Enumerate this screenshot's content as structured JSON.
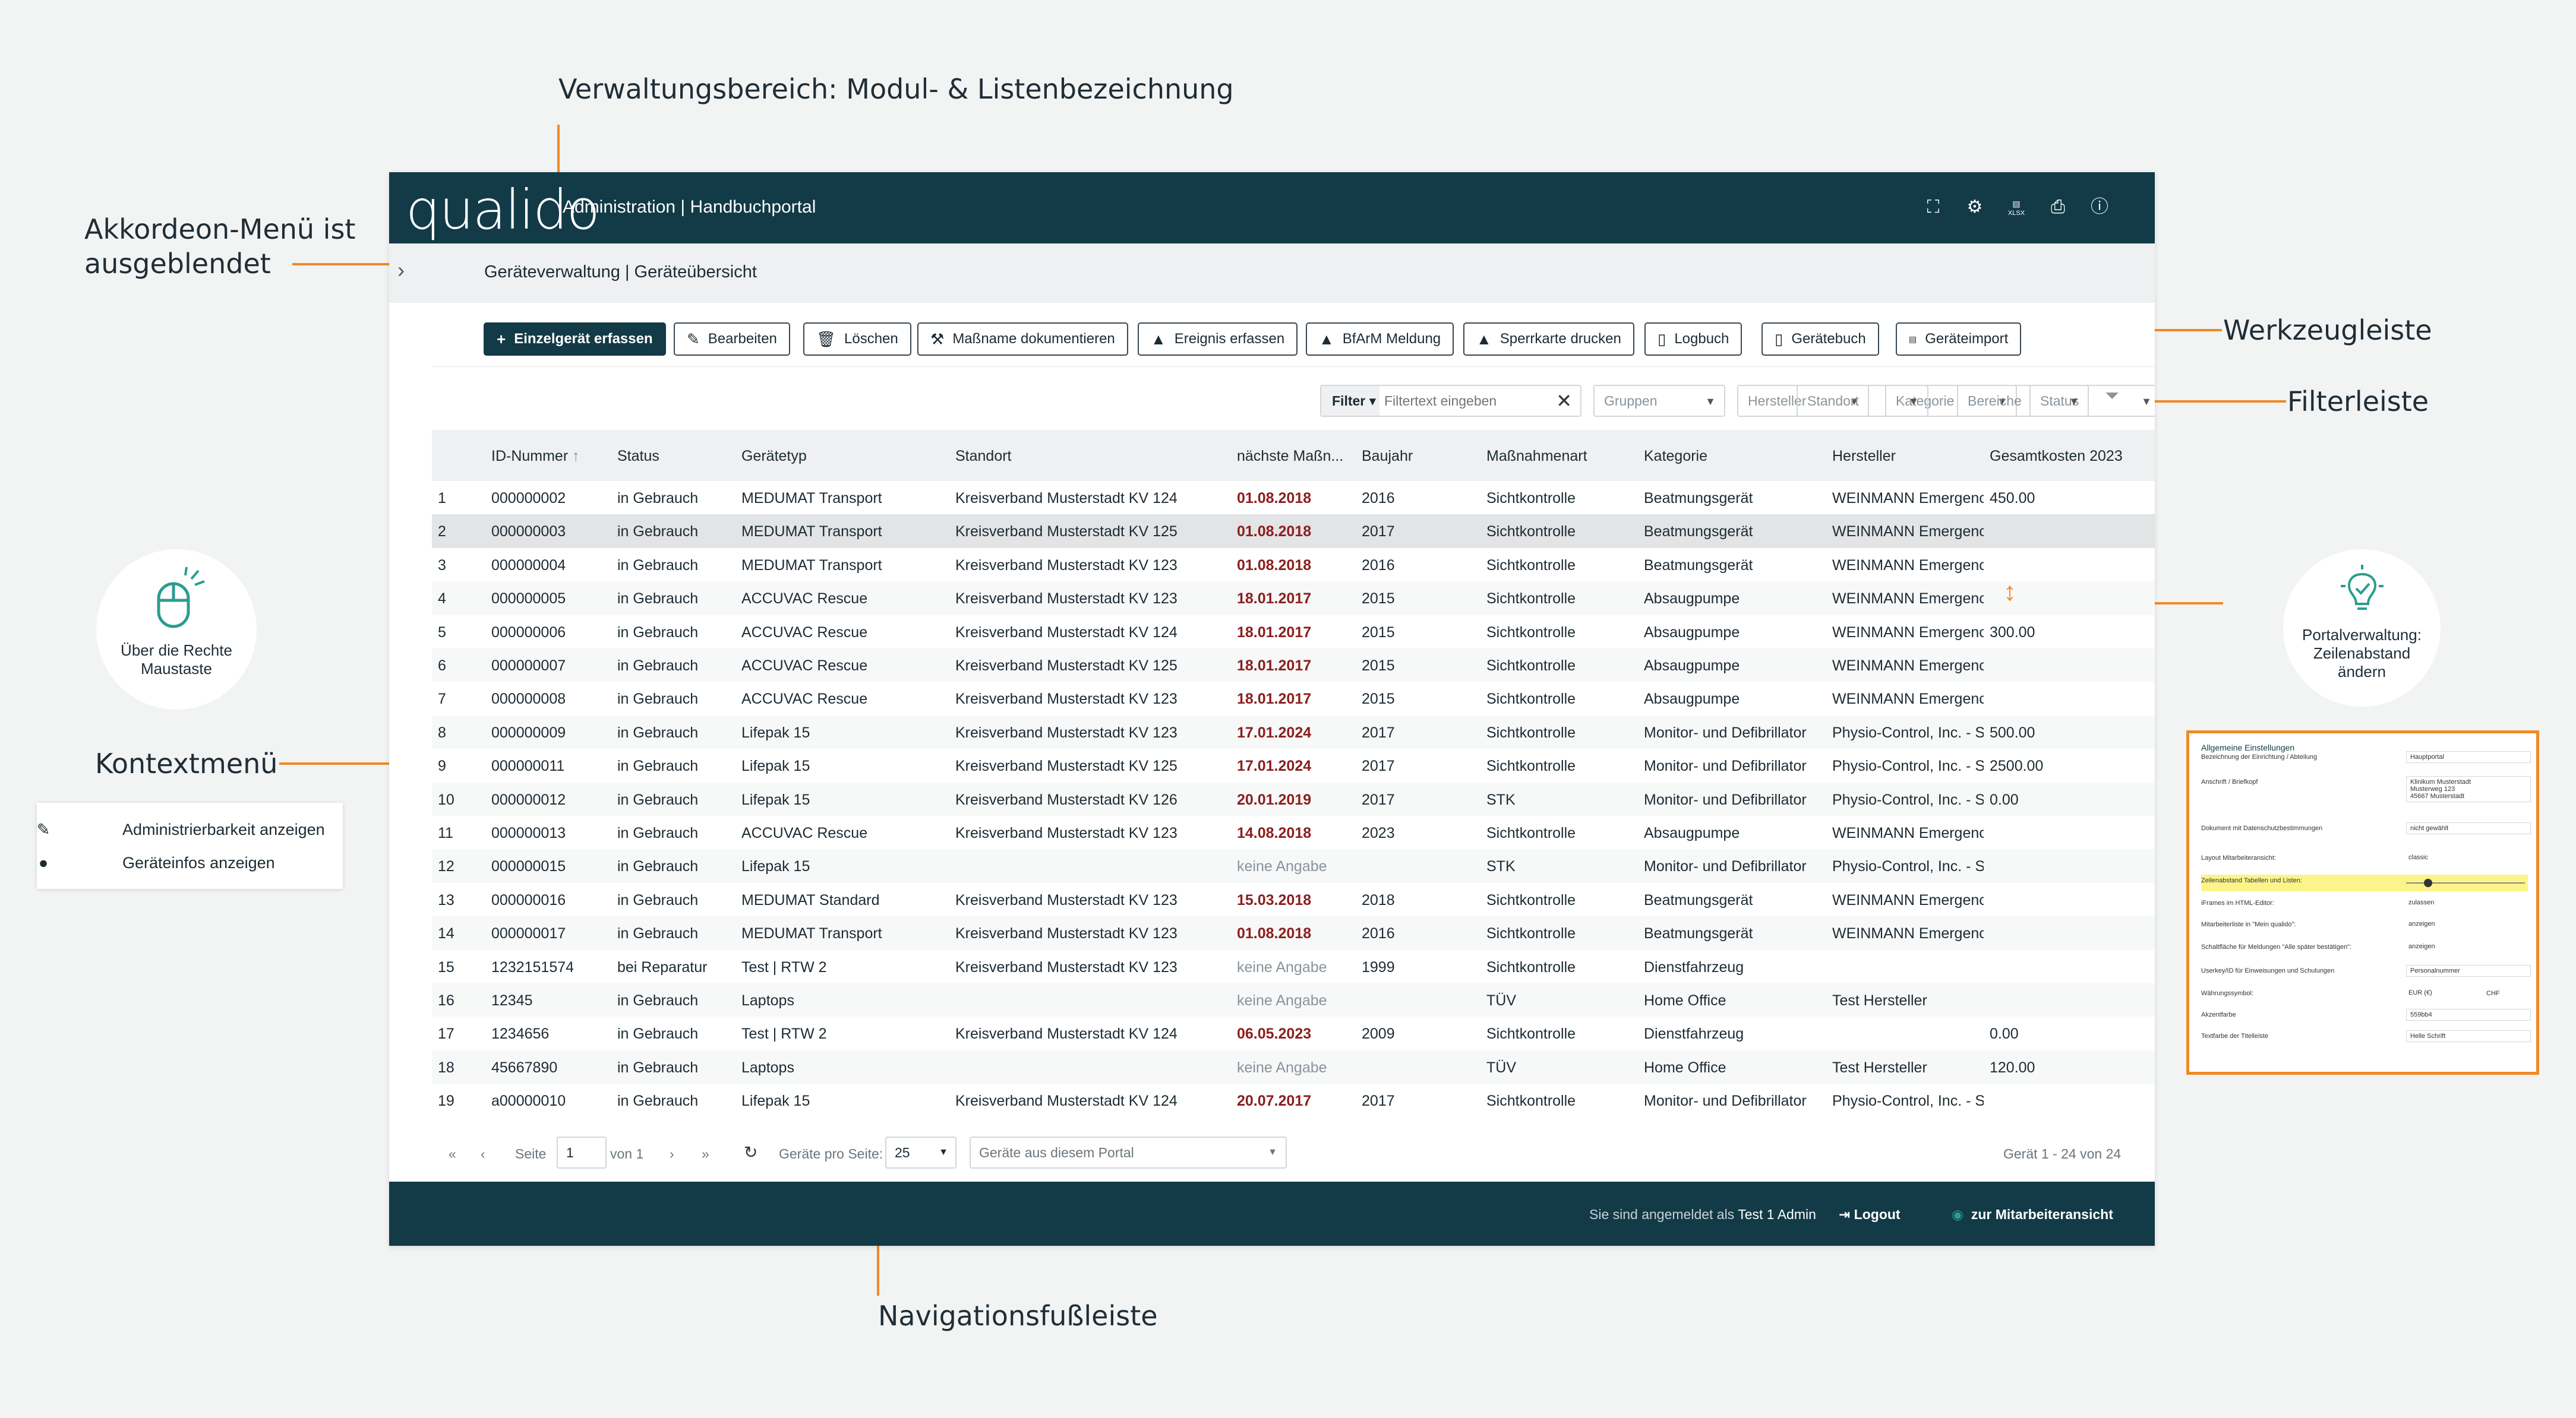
{
  "annotations": {
    "admin_area": "Verwaltungsbereich: Modul- & Listenbezeichnung",
    "accordion_line1": "Akkordeon-Menü ist",
    "accordion_line2": "ausgeblendet",
    "toolbar": "Werkzeugleiste",
    "filterbar": "Filterleiste",
    "context_menu": "Kontextmenü",
    "footer_nav": "Navigationsfußleiste",
    "mouse_badge_line1": "Über die Rechte",
    "mouse_badge_line2": "Maustaste",
    "portal_badge_line1": "Portalverwaltung:",
    "portal_badge_line2": "Zeilenabstand",
    "portal_badge_line3": "ändern"
  },
  "colors": {
    "primary": "#123a47",
    "accent": "#f08a24",
    "date_red": "#8b1e1e"
  },
  "app": {
    "logo": "qualido",
    "title": "Administration | Handbuchportal",
    "top_icons": [
      "scan-icon",
      "settings-icon",
      "xlsx-export-icon",
      "print-icon",
      "help-icon"
    ]
  },
  "breadcrumb": "Geräteverwaltung | Geräteübersicht",
  "toolbar": {
    "new": "Einzelgerät erfassen",
    "edit": "Bearbeiten",
    "delete": "Löschen",
    "measure": "Maßname dokumentieren",
    "event": "Ereignis erfassen",
    "bfarm": "BfArM Meldung",
    "lockcard": "Sperrkarte drucken",
    "logbook": "Logbuch",
    "devicebook": "Gerätebuch",
    "import": "Geräteimport",
    "xlsx_label": "XLSX"
  },
  "filters": {
    "label": "Filter",
    "placeholder": "Filtertext eingeben",
    "selects": [
      "Gruppen",
      "Hersteller",
      "Kategorie",
      "Status",
      "Standort",
      "Bereiche"
    ]
  },
  "table": {
    "columns": [
      "ID-Nummer",
      "Status",
      "Gerätetyp",
      "Standort",
      "nächste Maßn...",
      "Baujahr",
      "Maßnahmenart",
      "Kategorie",
      "Hersteller",
      "Gesamtkosten 2023"
    ],
    "sort_indicator": "↑",
    "rows": [
      [
        "1",
        "000000002",
        "in Gebrauch",
        "MEDUMAT Transport",
        "Kreisverband Musterstadt KV 124",
        "01.08.2018",
        "2016",
        "Sichtkontrolle",
        "Beatmungsgerät",
        "WEINMANN Emergenc",
        "450.00"
      ],
      [
        "2",
        "000000003",
        "in Gebrauch",
        "MEDUMAT Transport",
        "Kreisverband Musterstadt KV 125",
        "01.08.2018",
        "2017",
        "Sichtkontrolle",
        "Beatmungsgerät",
        "WEINMANN Emergenc",
        ""
      ],
      [
        "3",
        "000000004",
        "in Gebrauch",
        "MEDUMAT Transport",
        "Kreisverband Musterstadt KV 123",
        "01.08.2018",
        "2016",
        "Sichtkontrolle",
        "Beatmungsgerät",
        "WEINMANN Emergenc",
        ""
      ],
      [
        "4",
        "000000005",
        "in Gebrauch",
        "ACCUVAC Rescue",
        "Kreisverband Musterstadt KV 123",
        "18.01.2017",
        "2015",
        "Sichtkontrolle",
        "Absaugpumpe",
        "WEINMANN Emergenc",
        ""
      ],
      [
        "5",
        "000000006",
        "in Gebrauch",
        "ACCUVAC Rescue",
        "Kreisverband Musterstadt KV 124",
        "18.01.2017",
        "2015",
        "Sichtkontrolle",
        "Absaugpumpe",
        "WEINMANN Emergenc",
        "300.00"
      ],
      [
        "6",
        "000000007",
        "in Gebrauch",
        "ACCUVAC Rescue",
        "Kreisverband Musterstadt KV 125",
        "18.01.2017",
        "2015",
        "Sichtkontrolle",
        "Absaugpumpe",
        "WEINMANN Emergenc",
        ""
      ],
      [
        "7",
        "000000008",
        "in Gebrauch",
        "ACCUVAC Rescue",
        "Kreisverband Musterstadt KV 123",
        "18.01.2017",
        "2015",
        "Sichtkontrolle",
        "Absaugpumpe",
        "WEINMANN Emergenc",
        ""
      ],
      [
        "8",
        "000000009",
        "in Gebrauch",
        "Lifepak 15",
        "Kreisverband Musterstadt KV 123",
        "17.01.2024",
        "2017",
        "Sichtkontrolle",
        "Monitor- und Defibrillator",
        "Physio-Control, Inc. - St",
        "500.00"
      ],
      [
        "9",
        "000000011",
        "in Gebrauch",
        "Lifepak 15",
        "Kreisverband Musterstadt KV 125",
        "17.01.2024",
        "2017",
        "Sichtkontrolle",
        "Monitor- und Defibrillator",
        "Physio-Control, Inc. - St",
        "2500.00"
      ],
      [
        "10",
        "000000012",
        "in Gebrauch",
        "Lifepak 15",
        "Kreisverband Musterstadt KV 126",
        "20.01.2019",
        "2017",
        "STK",
        "Monitor- und Defibrillator",
        "Physio-Control, Inc. - St",
        "0.00"
      ],
      [
        "11",
        "000000013",
        "in Gebrauch",
        "ACCUVAC Rescue",
        "Kreisverband Musterstadt KV 123",
        "14.08.2018",
        "2023",
        "Sichtkontrolle",
        "Absaugpumpe",
        "WEINMANN Emergenc",
        ""
      ],
      [
        "12",
        "000000015",
        "in Gebrauch",
        "Lifepak 15",
        "",
        "keine Angabe",
        "",
        "STK",
        "Monitor- und Defibrillator",
        "Physio-Control, Inc. - St",
        ""
      ],
      [
        "13",
        "000000016",
        "in Gebrauch",
        "MEDUMAT Standard",
        "Kreisverband Musterstadt KV 123",
        "15.03.2018",
        "2018",
        "Sichtkontrolle",
        "Beatmungsgerät",
        "WEINMANN Emergenc",
        ""
      ],
      [
        "14",
        "000000017",
        "in Gebrauch",
        "MEDUMAT Transport",
        "Kreisverband Musterstadt KV 123",
        "01.08.2018",
        "2016",
        "Sichtkontrolle",
        "Beatmungsgerät",
        "WEINMANN Emergenc",
        ""
      ],
      [
        "15",
        "1232151574",
        "bei Reparatur",
        "Test | RTW 2",
        "Kreisverband Musterstadt KV 123",
        "keine Angabe",
        "1999",
        "Sichtkontrolle",
        "Dienstfahrzeug",
        "",
        ""
      ],
      [
        "16",
        "12345",
        "in Gebrauch",
        "Laptops",
        "",
        "keine Angabe",
        "",
        "TÜV",
        "Home Office",
        "Test Hersteller",
        ""
      ],
      [
        "17",
        "1234656",
        "in Gebrauch",
        "Test | RTW 2",
        "Kreisverband Musterstadt KV 124",
        "06.05.2023",
        "2009",
        "Sichtkontrolle",
        "Dienstfahrzeug",
        "",
        "0.00"
      ],
      [
        "18",
        "45667890",
        "in Gebrauch",
        "Laptops",
        "",
        "keine Angabe",
        "",
        "TÜV",
        "Home Office",
        "Test Hersteller",
        "120.00"
      ],
      [
        "19",
        "a00000010",
        "in Gebrauch",
        "Lifepak 15",
        "Kreisverband Musterstadt KV 124",
        "20.07.2017",
        "2017",
        "Sichtkontrolle",
        "Monitor- und Defibrillator",
        "Physio-Control, Inc. - St",
        ""
      ]
    ]
  },
  "pager": {
    "first": "«",
    "prev": "‹",
    "next": "›",
    "last": "»",
    "page_label": "Seite",
    "page_value": "1",
    "of_label": "von 1",
    "refresh": "↻",
    "per_page_label": "Geräte pro Seite:",
    "per_page_value": "25",
    "scope_value": "Geräte aus diesem Portal",
    "count": "Gerät 1 - 24 von 24"
  },
  "footer": {
    "logged_in": "Sie sind angemeldet als",
    "user": "Test 1 Admin",
    "logout": "Logout",
    "employee_view": "zur Mitarbeiteransicht"
  },
  "context_menu": {
    "item1": "Administrierbarkeit anzeigen",
    "item2": "Geräteinfos anzeigen"
  },
  "settings_panel": {
    "title": "Allgemeine Einstellungen",
    "rows": [
      {
        "label": "Bezeichnung der Einrichtung / Abteilung",
        "value": "Hauptportal"
      },
      {
        "label": "Anschrift / Briefkopf",
        "value": "Klinikum Musterstadt\nMusterweg 123\n45667 Musterstadt"
      },
      {
        "label": "Dokument mit Datenschutzbestimmungen",
        "value": "nicht gewählt"
      },
      {
        "label": "Layout Mitarbeiteransicht:",
        "value": "classic"
      },
      {
        "label": "Zeilenabstand Tabellen und Listen:",
        "value": ""
      },
      {
        "label": "iFrames im HTML-Editor:",
        "value": "zulassen"
      },
      {
        "label": "Mitarbeiterliste in \"Mein qualido\":",
        "value": "anzeigen"
      },
      {
        "label": "Schaltfläche für Meldungen \"Alle später bestätigen\":",
        "value": "anzeigen"
      },
      {
        "label": "Userkey/ID für Einweisungen und Schulungen",
        "value": "Personalnummer"
      },
      {
        "label": "Währungssymbol:",
        "value": "EUR (€)"
      },
      {
        "label": "Akzentfarbe",
        "value": "559bb4"
      },
      {
        "label": "Textfarbe der Titelleiste",
        "value": "Helle Schrift"
      }
    ],
    "chf": "CHF"
  }
}
